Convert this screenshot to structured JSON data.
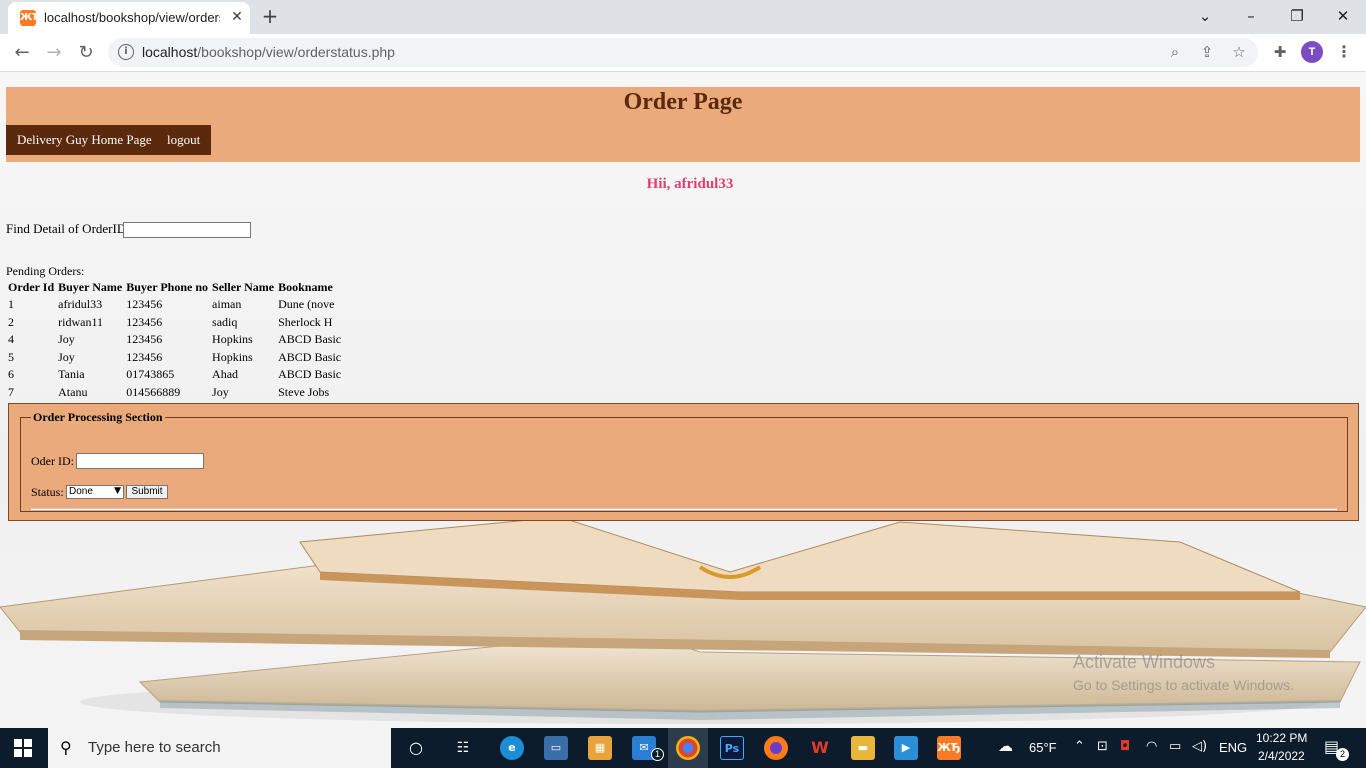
{
  "browser": {
    "tab_title": "localhost/bookshop/view/orderstatus.php",
    "tab_favicon_glyph": "ЖЂ",
    "url_host": "localhost",
    "url_path": "/bookshop/view/orderstatus.php",
    "profile_initial": "T"
  },
  "page": {
    "title": "Order Page",
    "nav_links": [
      "Delivery Guy Home Page",
      "logout"
    ],
    "greeting": "Hii, afridul33",
    "find_label": "Find Detail of OrderID:",
    "pending_label": "Pending Orders:",
    "table": {
      "headers": [
        "Order Id",
        "Buyer Name",
        "Buyer Phone no",
        "Seller Name",
        "Bookname"
      ],
      "rows": [
        [
          "1",
          "afridul33",
          "123456",
          "aiman",
          "Dune (nove"
        ],
        [
          "2",
          "ridwan11",
          "123456",
          "sadiq",
          "Sherlock H"
        ],
        [
          "4",
          "Joy",
          "123456",
          "Hopkins",
          "ABCD Basic"
        ],
        [
          "5",
          "Joy",
          "123456",
          "Hopkins",
          "ABCD Basic"
        ],
        [
          "6",
          "Tania",
          "01743865",
          "Ahad",
          "ABCD Basic"
        ],
        [
          "7",
          "Atanu",
          "014566889",
          "Joy",
          "Steve Jobs"
        ]
      ]
    },
    "processing": {
      "legend": "Order Processing Section",
      "order_id_label": "Oder ID:",
      "status_label": "Status:",
      "status_selected": "Done",
      "submit_label": "Submit"
    },
    "watermark": {
      "line1": "Activate Windows",
      "line2": "Go to Settings to activate Windows."
    }
  },
  "taskbar": {
    "search_placeholder": "Type here to search",
    "weather": "65°F",
    "language": "ENG",
    "time": "10:22 PM",
    "date": "2/4/2022",
    "notification_count": "2",
    "mail_badge": "1"
  },
  "colors": {
    "header_bg": "#eaaa7b",
    "nav_bg": "#5b2a0c",
    "greeting": "#e0406e",
    "taskbar_bg": "#0c1c2c"
  }
}
